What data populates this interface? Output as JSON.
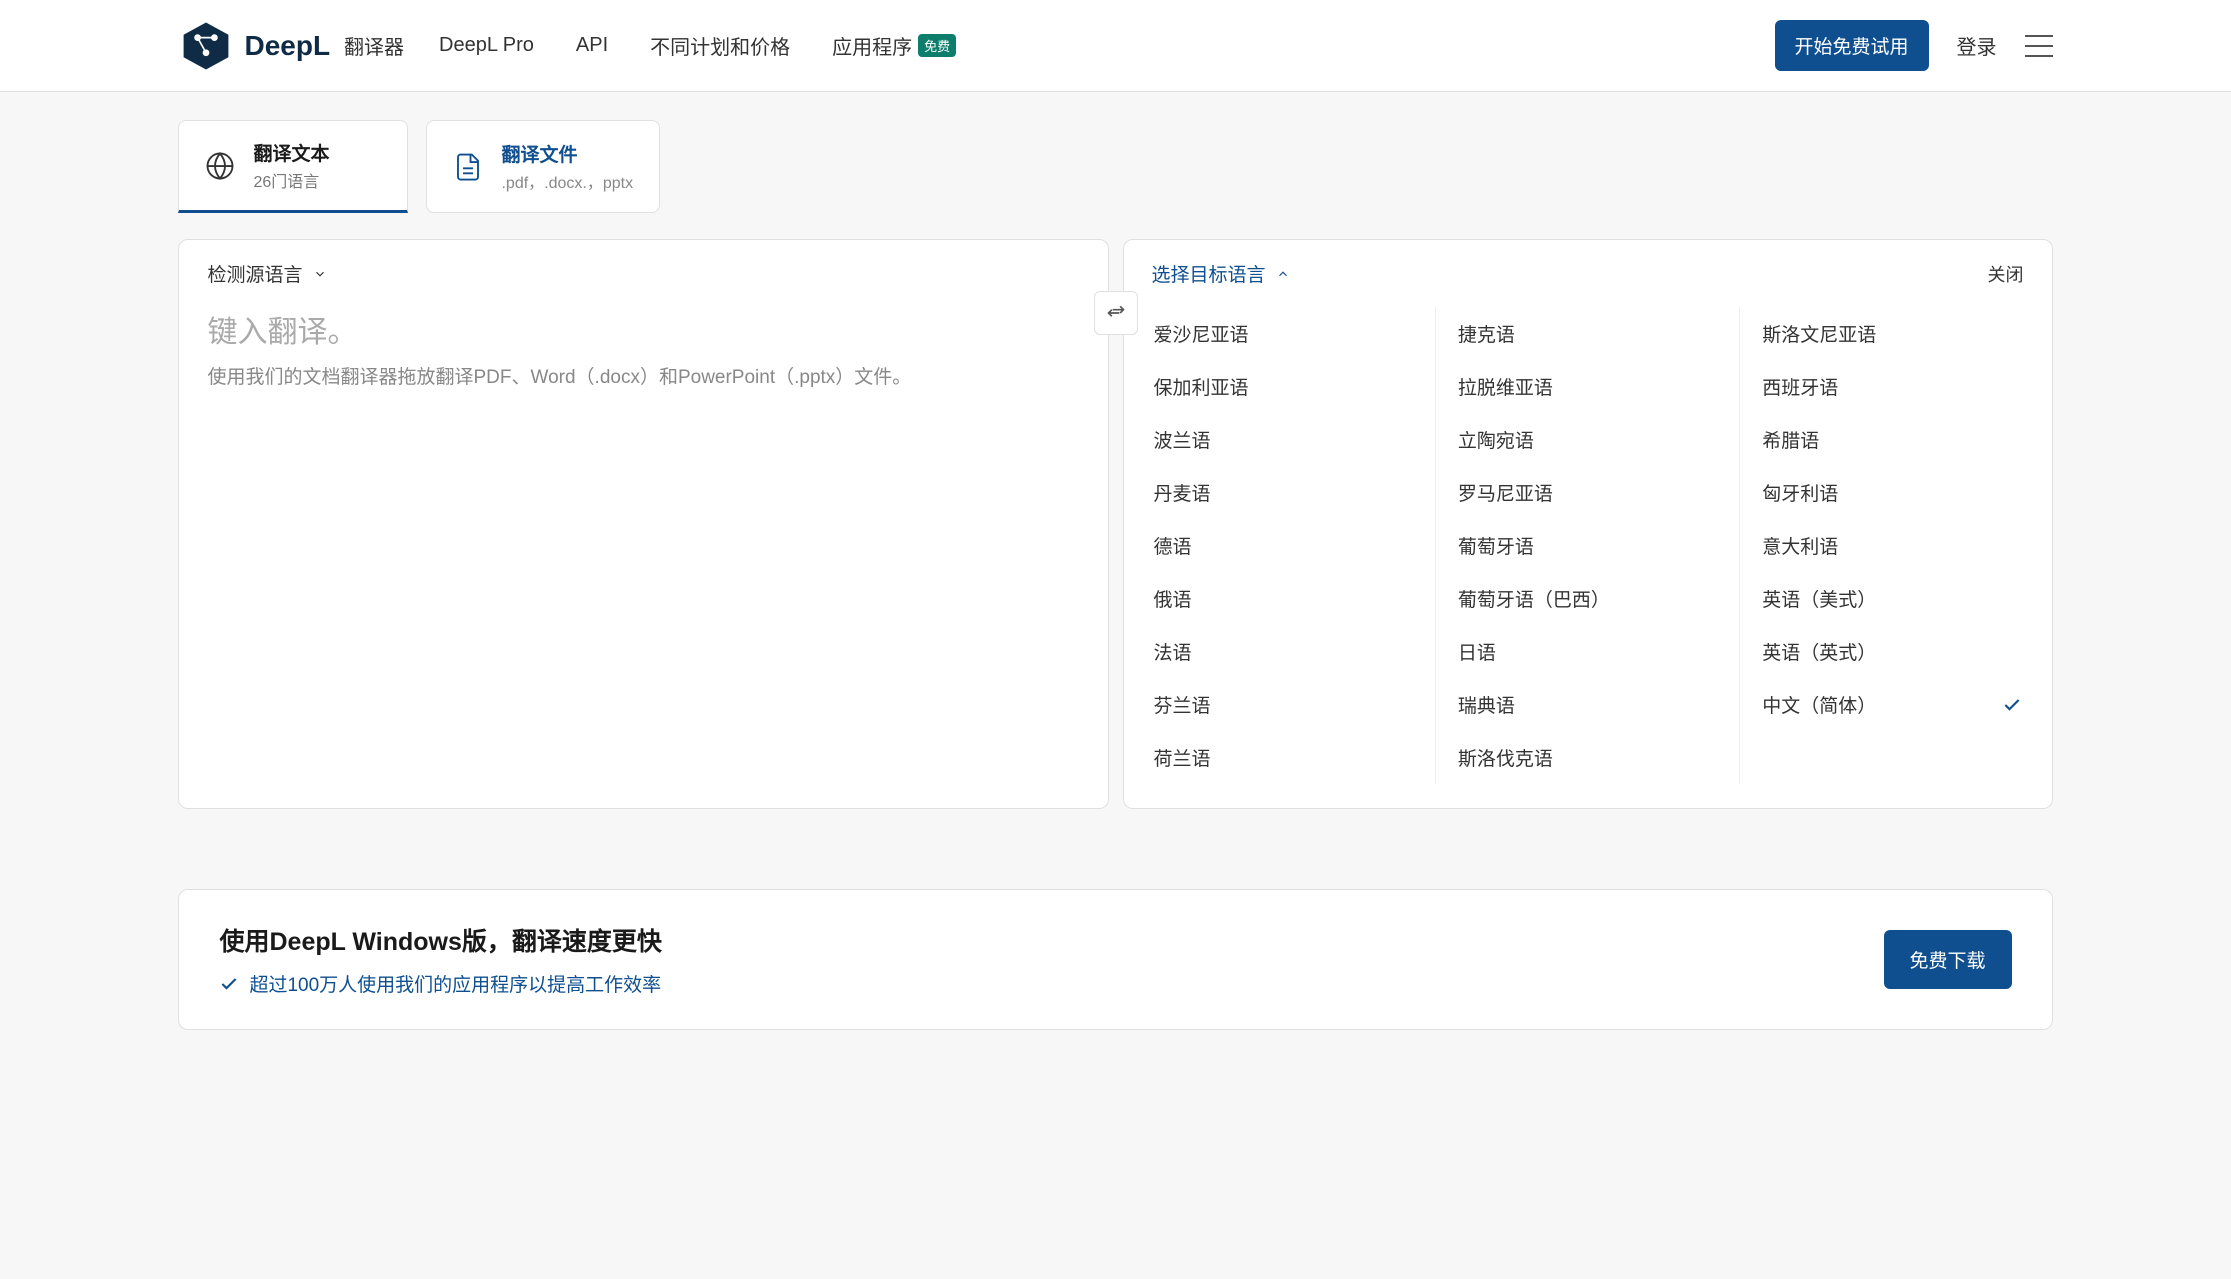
{
  "header": {
    "brand": "DeepL",
    "brand_sub": "翻译器",
    "nav": {
      "pro": "DeepL Pro",
      "api": "API",
      "plans": "不同计划和价格",
      "apps": "应用程序",
      "badge": "免费"
    },
    "start_trial": "开始免费试用",
    "login": "登录"
  },
  "tabs": {
    "text": {
      "title": "翻译文本",
      "sub": "26门语言"
    },
    "file": {
      "title": "翻译文件",
      "sub": ".pdf，.docx.，pptx"
    }
  },
  "source": {
    "label": "检测源语言",
    "placeholder": "键入翻译。",
    "hint": "使用我们的文档翻译器拖放翻译PDF、Word（.docx）和PowerPoint（.pptx）文件。"
  },
  "target": {
    "label": "选择目标语言",
    "close": "关闭",
    "selected": "中文（简体）",
    "columns": [
      [
        "爱沙尼亚语",
        "保加利亚语",
        "波兰语",
        "丹麦语",
        "德语",
        "俄语",
        "法语",
        "芬兰语",
        "荷兰语"
      ],
      [
        "捷克语",
        "拉脱维亚语",
        "立陶宛语",
        "罗马尼亚语",
        "葡萄牙语",
        "葡萄牙语（巴西）",
        "日语",
        "瑞典语",
        "斯洛伐克语"
      ],
      [
        "斯洛文尼亚语",
        "西班牙语",
        "希腊语",
        "匈牙利语",
        "意大利语",
        "英语（美式）",
        "英语（英式）",
        "中文（简体）"
      ]
    ]
  },
  "promo": {
    "title": "使用DeepL Windows版，翻译速度更快",
    "sub": "超过100万人使用我们的应用程序以提高工作效率",
    "download": "免费下载"
  }
}
